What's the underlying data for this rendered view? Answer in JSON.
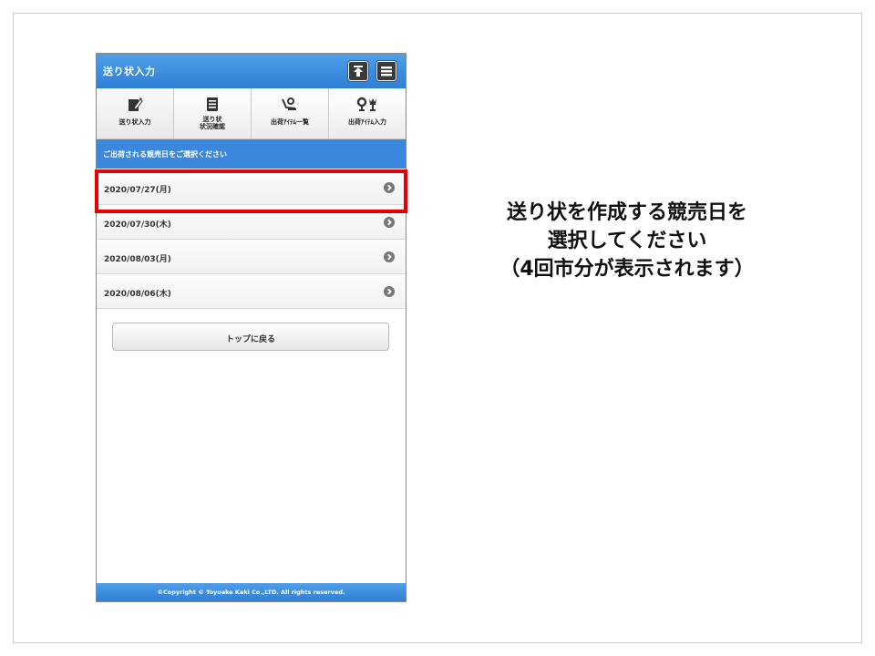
{
  "app": {
    "title": "送り状入力"
  },
  "header_buttons": {
    "top_icon": "arrow-up-to-top-icon",
    "menu_icon": "hamburger-menu-icon"
  },
  "tabs": [
    {
      "label_lines": [
        "送り状入力"
      ],
      "icon": "pencil-document-icon"
    },
    {
      "label_lines": [
        "送り状",
        "状況確認"
      ],
      "icon": "list-document-icon"
    },
    {
      "label_lines": [
        "出荷ｱｲﾃﾑ一覧"
      ],
      "icon": "flower-hand-icon"
    },
    {
      "label_lines": [
        "出荷ｱｲﾃﾑ入力"
      ],
      "icon": "flowers-icon"
    }
  ],
  "prompt": "ご出荷される競売日をご選択ください",
  "dates": [
    {
      "label": "2020/07/27(月)"
    },
    {
      "label": "2020/07/30(木)"
    },
    {
      "label": "2020/08/03(月)"
    },
    {
      "label": "2020/08/06(木)"
    }
  ],
  "back_button": "トップに戻る",
  "footer": "©Copyright © Toyoake Kaki Co.,LTD. All rights reserved.",
  "caption": {
    "line1": "送り状を作成する競売日を",
    "line2": "選択してください",
    "line3": "（4回市分が表示されます）"
  },
  "colors": {
    "header_blue": "#3b87dd",
    "highlight_red": "#e60000"
  }
}
